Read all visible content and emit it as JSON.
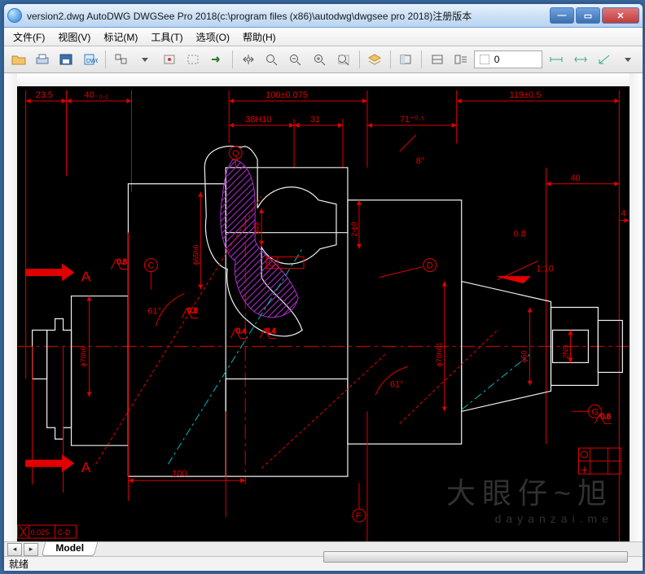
{
  "window": {
    "title": "version2.dwg AutoDWG DWGSee Pro 2018(c:\\program files (x86)\\autodwg\\dwgsee pro 2018)注册版本"
  },
  "menu": {
    "items": [
      "文件(F)",
      "视图(V)",
      "标记(M)",
      "工具(T)",
      "选项(O)",
      "帮助(H)"
    ]
  },
  "toolbar": {
    "icons": [
      "open-icon",
      "print-icon",
      "save-icon",
      "export-icon",
      "sep",
      "select-all-icon",
      "dropdown-icon",
      "tool-a-icon",
      "tool-b-icon",
      "arrow-right-icon",
      "sep",
      "pan-icon",
      "zoom-icon",
      "zoom-out-icon",
      "zoom-in-icon",
      "zoom-extents-icon",
      "sep",
      "layer-icon",
      "sep",
      "layout-a-icon",
      "sep",
      "layout-b-icon",
      "props-icon"
    ],
    "field_value": "0",
    "right_icons": [
      "dim-a-icon",
      "dim-b-icon",
      "dim-c-icon",
      "dim-d-icon"
    ]
  },
  "drawing": {
    "dimensions_top": [
      "23.5",
      "40₋₀.₂",
      "100±0.075",
      "119±0.5"
    ],
    "dimensions_mid": [
      "38H10",
      "31",
      "71⁺⁰·⁵"
    ],
    "dimensions_right": [
      "40",
      "4",
      "0.8"
    ],
    "callouts": [
      "Q",
      "C",
      "D",
      "F",
      "G"
    ],
    "diameters": [
      "ϕ65h6",
      "ϕ70h6",
      "ϕ45",
      "2-ϕ8",
      "ϕ70h61",
      "ϕ50",
      "2N9"
    ],
    "angles": [
      "61°",
      "61°",
      "8°"
    ],
    "ratio": "1:10",
    "roughness": [
      "0.8",
      "0.8",
      "0.4",
      "0.4",
      "0.8"
    ],
    "section": {
      "arrow_label": "A",
      "tolerance": "0.025",
      "datum": "C-D"
    },
    "bottom_dim": "100"
  },
  "tabs": {
    "sheet": "Model"
  },
  "status": {
    "text": "就绪"
  },
  "watermark": {
    "cn": "大眼仔~旭",
    "en": "dayanzai.me"
  }
}
